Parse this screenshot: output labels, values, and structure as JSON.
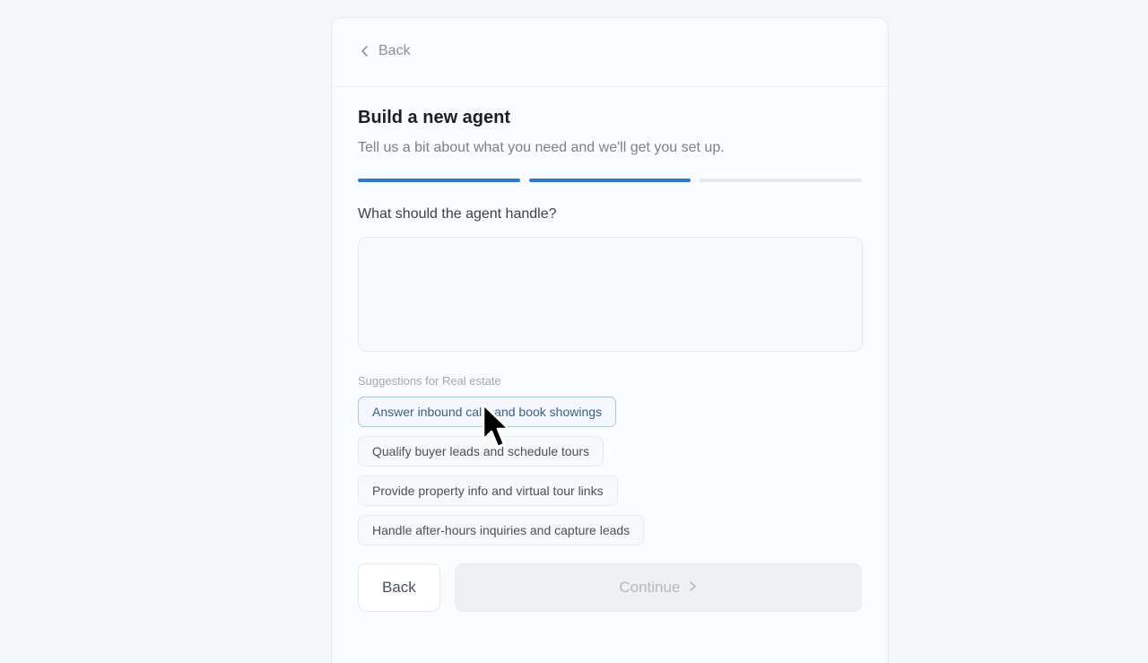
{
  "header": {
    "back_label": "Back"
  },
  "main": {
    "title": "Build a new agent",
    "subtitle": "Tell us a bit about what you need and we'll get you set up.",
    "progress": {
      "current_step": 2,
      "total_steps": 3
    },
    "question": "What should the agent handle?",
    "answer": {
      "value": "",
      "placeholder": ""
    },
    "suggestions_label": "Suggestions for Real estate",
    "suggestions": [
      "Answer inbound calls and book showings",
      "Qualify buyer leads and schedule tours",
      "Provide property info and virtual tour links",
      "Handle after-hours inquiries and capture leads"
    ]
  },
  "footer": {
    "back_label": "Back",
    "continue_label": "Continue"
  },
  "icons": {
    "back": "chevron-left-icon",
    "continue": "chevron-right-icon",
    "cursor": "mouse-pointer-icon"
  },
  "colors": {
    "accent": "#2d7bd0",
    "progress_inactive": "#e6e8eb",
    "chip_hover_border": "#a9c7e6"
  }
}
